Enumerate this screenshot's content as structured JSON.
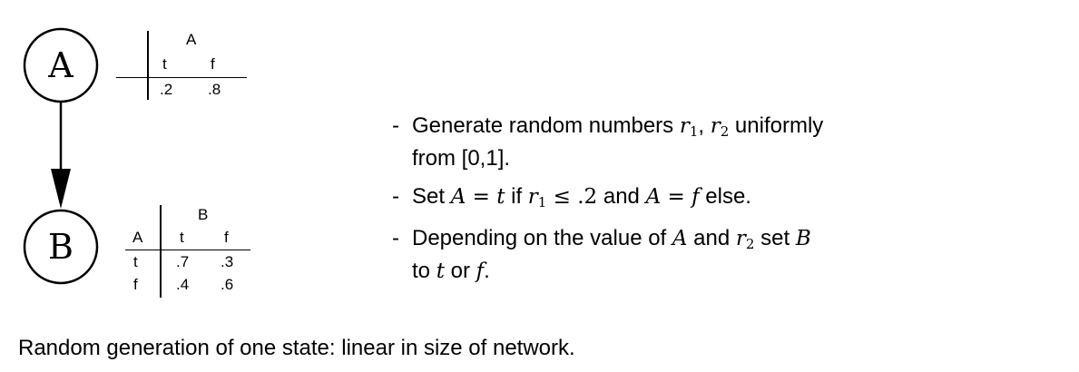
{
  "network": {
    "nodes": [
      {
        "id": "A",
        "label": "A"
      },
      {
        "id": "B",
        "label": "B"
      }
    ],
    "edges": [
      {
        "from": "A",
        "to": "B"
      }
    ]
  },
  "cpt_a": {
    "var": "A",
    "col_values": [
      "t",
      "f"
    ],
    "probs": [
      ".2",
      ".8"
    ]
  },
  "cpt_b": {
    "var": "B",
    "parent": "A",
    "col_values": [
      "t",
      "f"
    ],
    "rows": [
      {
        "parent_value": "t",
        "probs": [
          ".7",
          ".3"
        ]
      },
      {
        "parent_value": "f",
        "probs": [
          ".4",
          ".6"
        ]
      }
    ]
  },
  "steps": {
    "s1": {
      "dash": "-",
      "a": "Generate random numbers ",
      "r1": "r",
      "r1_sub": "1",
      "comma": ", ",
      "r2": "r",
      "r2_sub": "2",
      "b": " uniformly",
      "c": "from [0,1]."
    },
    "s2": {
      "dash": "-",
      "a": "Set ",
      "eq1": "A = t",
      "b": " if ",
      "r": "r",
      "r_sub": "1",
      "cond": " ≤ .2",
      "c": " and ",
      "eq2": "A = f",
      "d": " else."
    },
    "s3": {
      "dash": "-",
      "a": "Depending on the value of ",
      "va": "A",
      "b": " and ",
      "r": "r",
      "r_sub": "2",
      "c": " set ",
      "vb": "B",
      "d": "to ",
      "vt": "t",
      "e": " or ",
      "vf": "f",
      "f": "."
    }
  },
  "footer": "Random generation of one state: linear in size of network."
}
